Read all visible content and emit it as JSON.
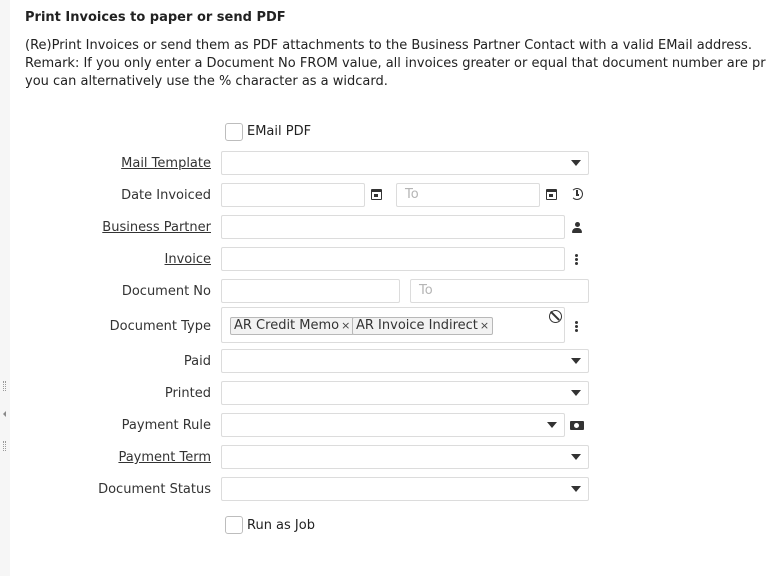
{
  "title": "Print Invoices to paper or send PDF",
  "description": [
    "(Re)Print Invoices or send them as PDF attachments to the Business Partner Contact with a valid EMail address.",
    "Remark: If you only enter a Document No FROM value, all invoices greater or equal that document number are printed;",
    "you can alternatively use the % character as a widcard."
  ],
  "email_pdf": {
    "label": "EMail PDF",
    "checked": false
  },
  "fields": {
    "mail_template": {
      "label": "Mail Template",
      "value": ""
    },
    "date_invoiced": {
      "label": "Date Invoiced",
      "from": "",
      "to_placeholder": "To"
    },
    "business_partner": {
      "label": "Business Partner",
      "value": ""
    },
    "invoice": {
      "label": "Invoice",
      "value": ""
    },
    "document_no": {
      "label": "Document No",
      "from": "",
      "to_placeholder": "To"
    },
    "document_type": {
      "label": "Document Type",
      "tags": [
        "AR Credit Memo",
        "AR Invoice Indirect"
      ],
      "remove_glyph": "×"
    },
    "paid": {
      "label": "Paid",
      "value": ""
    },
    "printed": {
      "label": "Printed",
      "value": ""
    },
    "payment_rule": {
      "label": "Payment Rule",
      "value": ""
    },
    "payment_term": {
      "label": "Payment Term",
      "value": ""
    },
    "document_status": {
      "label": "Document Status",
      "value": ""
    }
  },
  "run_as_job": {
    "label": "Run as Job",
    "checked": false
  },
  "icons": {
    "dropdown": "chevron-down-icon",
    "date": "calendar-icon",
    "history": "history-icon",
    "partner": "person-icon",
    "menu": "kebab-menu-icon",
    "clear": "clear-icon",
    "payment": "cash-icon"
  },
  "colors": {
    "border": "#dcdcdc",
    "tag_bg": "#f2f2f2",
    "side_strip": "#f6f6f6",
    "text": "#222222"
  }
}
